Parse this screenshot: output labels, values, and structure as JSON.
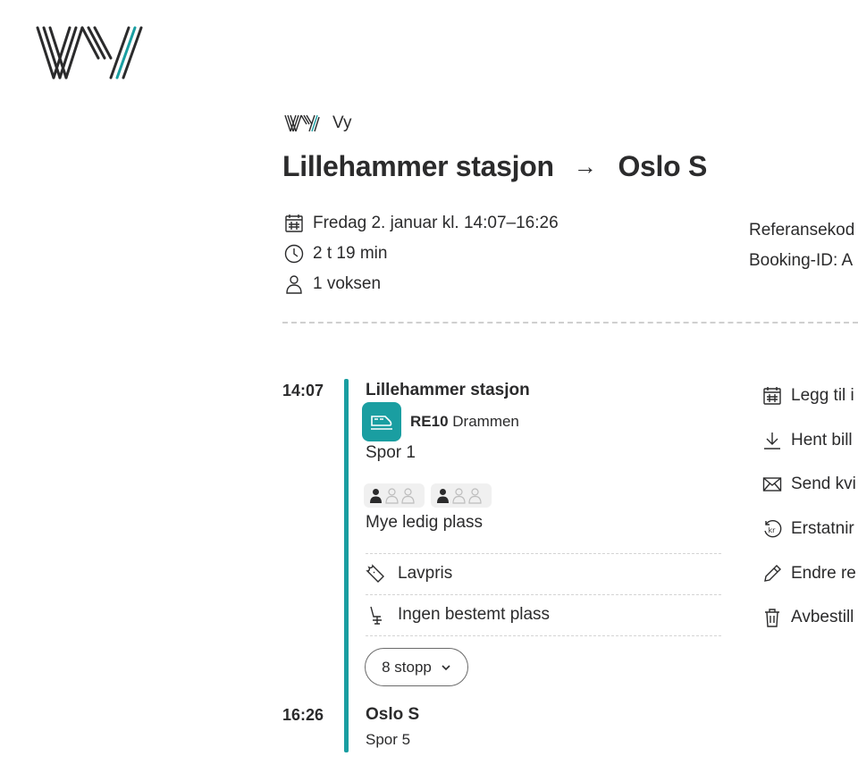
{
  "brand": {
    "name": "Vy"
  },
  "trip": {
    "from": "Lillehammer stasjon",
    "arrow": "→",
    "to": "Oslo S",
    "date": "Fredag 2. januar kl. 14:07–16:26",
    "duration": "2 t 19 min",
    "passengers": "1 voksen"
  },
  "reference": {
    "code_label": "Referansekod",
    "booking_label": "Booking-ID: A"
  },
  "journey": {
    "departure_time": "14:07",
    "departure_station": "Lillehammer stasjon",
    "line": "RE10",
    "destination": "Drammen",
    "departure_track": "Spor 1",
    "occupancy_text": "Mye ledig plass",
    "fare": "Lavpris",
    "seat": "Ingen bestemt plass",
    "stops_button": "8 stopp",
    "arrival_time": "16:26",
    "arrival_station": "Oslo S",
    "arrival_track": "Spor 5"
  },
  "actions": [
    {
      "label": "Legg til i",
      "icon": "calendar-icon"
    },
    {
      "label": "Hent bill",
      "icon": "download-icon"
    },
    {
      "label": "Send kvi",
      "icon": "mail-icon"
    },
    {
      "label": "Erstatnir",
      "icon": "kr-refund-icon"
    },
    {
      "label": "Endre re",
      "icon": "pencil-icon"
    },
    {
      "label": "Avbestill",
      "icon": "trash-icon"
    }
  ],
  "colors": {
    "accent": "#1a9ea1",
    "text": "#2b2b2c",
    "divider": "#cfcfcf"
  }
}
